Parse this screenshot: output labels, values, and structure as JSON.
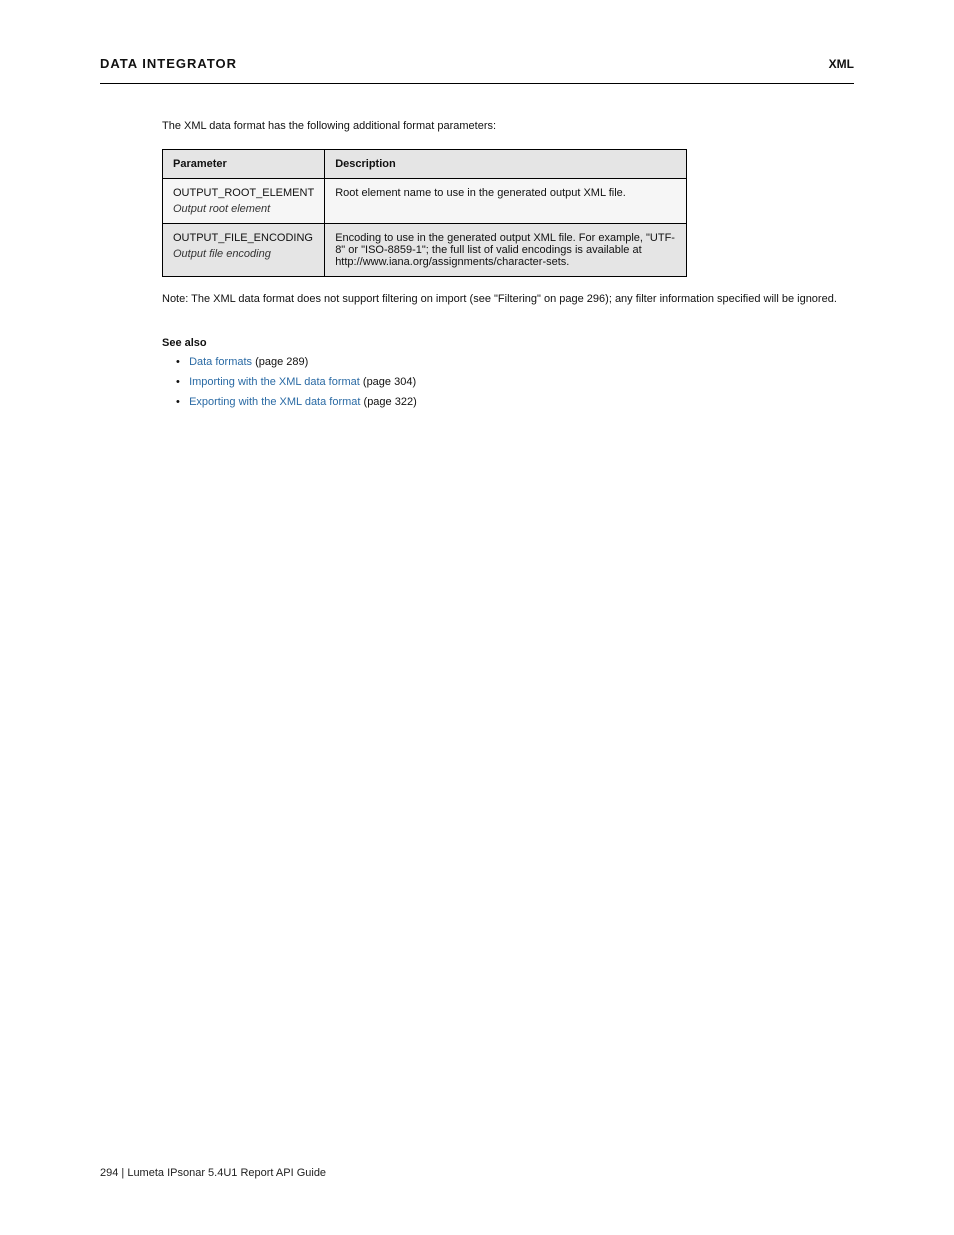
{
  "header": {
    "left": "DATA INTEGRATOR",
    "right": "XML"
  },
  "intro": "The XML data format has the following additional format parameters:",
  "table": {
    "head": [
      "Parameter",
      "Description"
    ],
    "rows": [
      {
        "param": "OUTPUT_ROOT_ELEMENT",
        "sub": "Output root element",
        "desc": "Root element name to use in the generated output XML file."
      },
      {
        "param": "OUTPUT_FILE_ENCODING",
        "sub": "Output file encoding",
        "desc": "Encoding to use in the generated output XML file. For example, \"UTF-8\" or \"ISO-8859-1\"; the full list of valid encodings is available at http://www.iana.org/assignments/character-sets."
      }
    ]
  },
  "note": "Note: The XML data format does not support filtering on import (see \"Filtering\" on page 296); any filter information specified will be ignored.",
  "seeAlso": {
    "label": "See also",
    "items": [
      {
        "text": "Data formats",
        "page": "(page 289)"
      },
      {
        "text": "Importing with the XML data format",
        "page": "(page 304)"
      },
      {
        "text": "Exporting with the XML data format",
        "page": "(page 322)"
      }
    ]
  },
  "footer": "294 | Lumeta IPsonar 5.4U1 Report API Guide"
}
